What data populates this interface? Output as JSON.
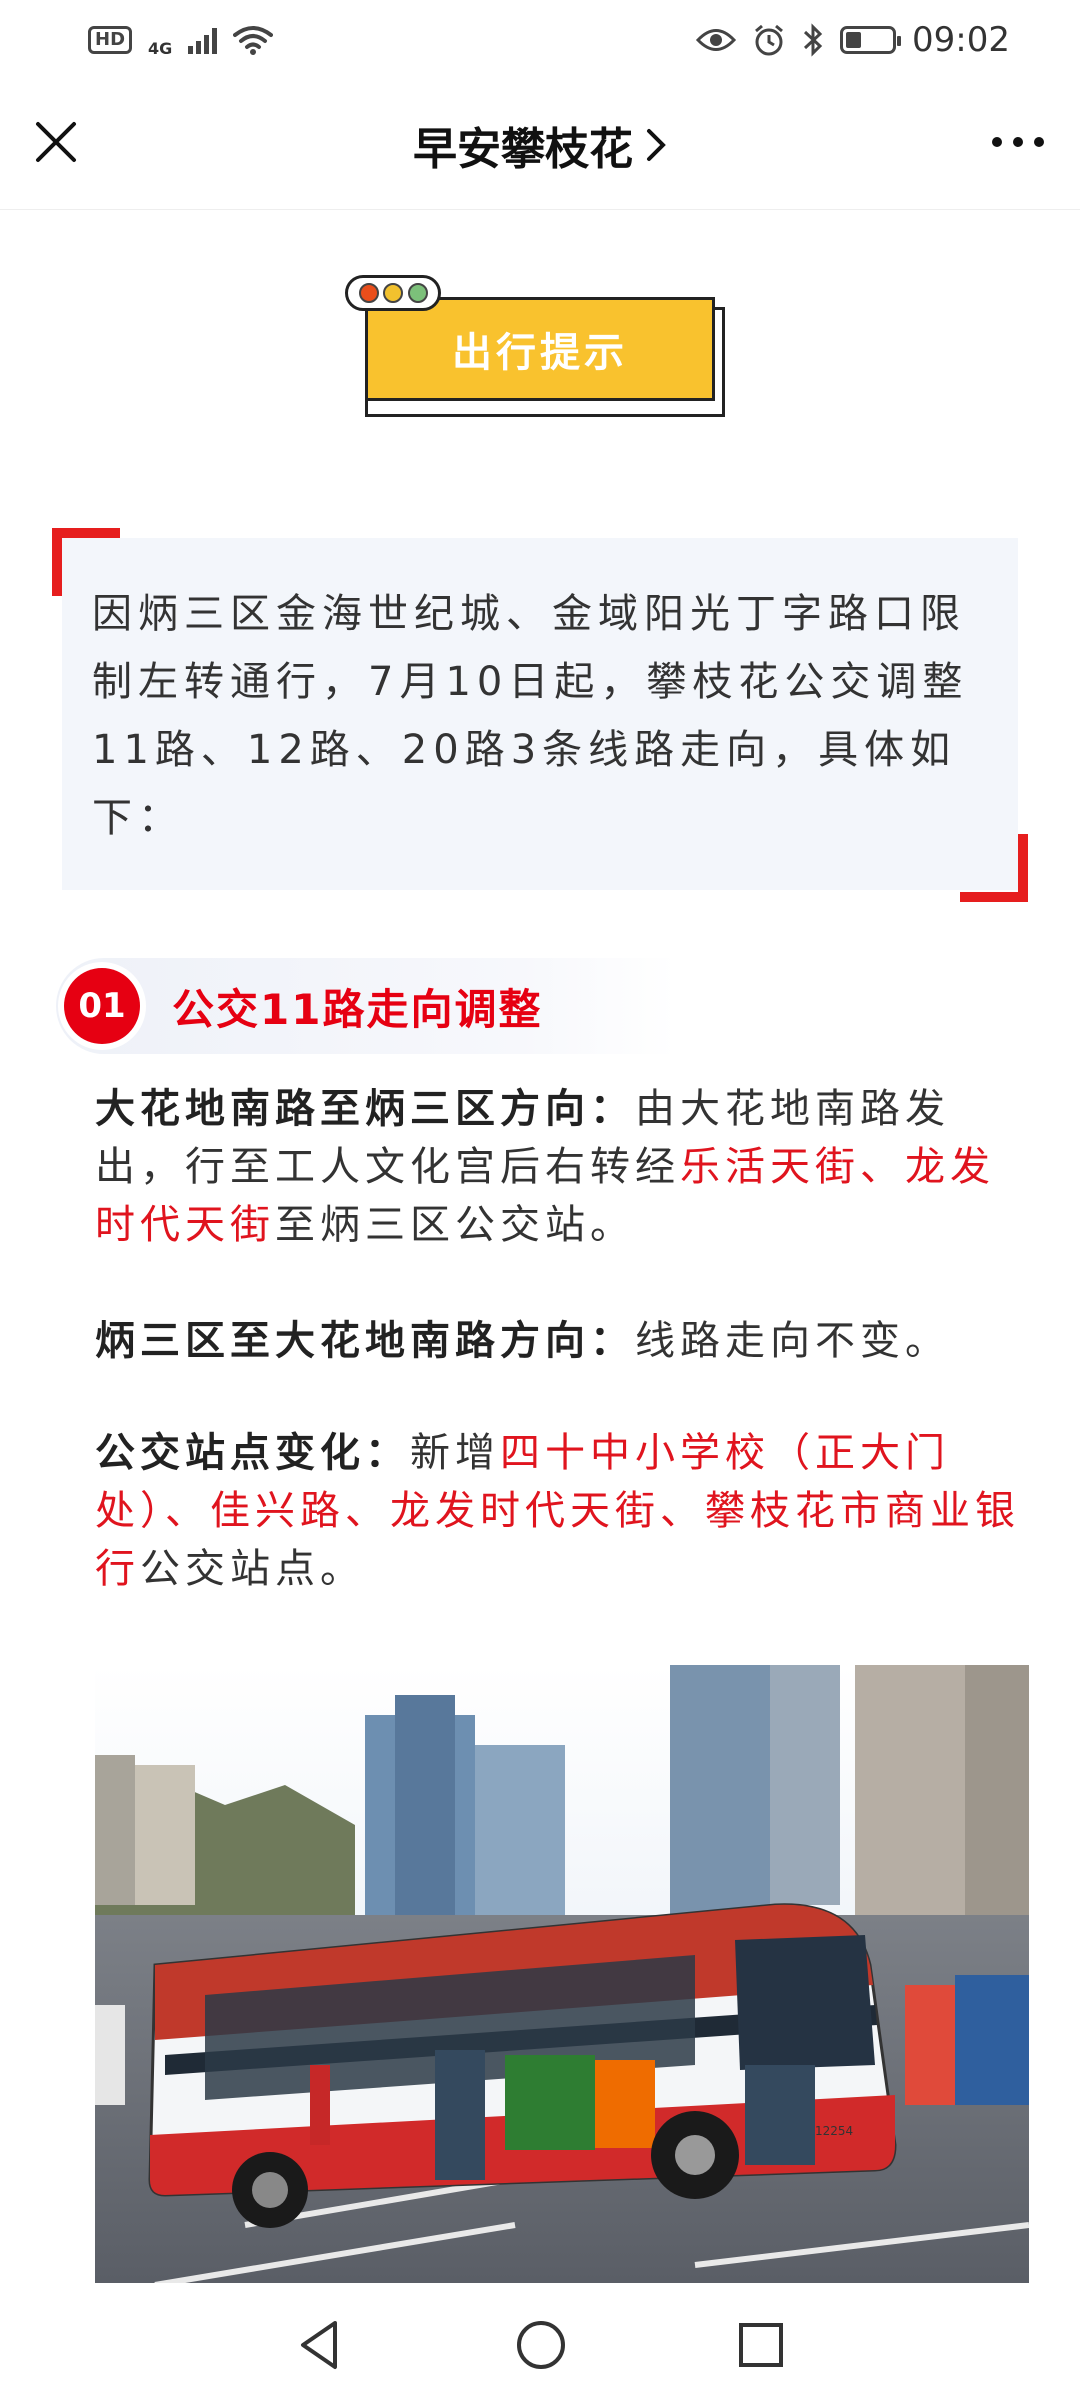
{
  "status_bar": {
    "hd": "HD",
    "network": "4G",
    "time": "09:02"
  },
  "nav": {
    "title": "早安攀枝花",
    "chevron": "›",
    "close_icon": "close-icon",
    "more_icon": "more-icon"
  },
  "tip_badge": {
    "label": "出行提示",
    "light_colors": [
      "#e94e1b",
      "#f2c12e",
      "#7cc07a"
    ]
  },
  "intro": {
    "text": "因炳三区金海世纪城、金域阳光丁字路口限制左转通行，7月10日起，攀枝花公交调整11路、12路、20路3条线路走向，具体如下："
  },
  "section": {
    "number": "01",
    "title": "公交11路走向调整"
  },
  "paragraphs": {
    "p1_label": "大花地南路至炳三区方向：",
    "p1_text_a": "由大花地南路发出，行至工人文化宫后右转经",
    "p1_highlight": "乐活天街、龙发时代天街",
    "p1_text_b": "至炳三区公交站。",
    "p2_label": "炳三区至大花地南路方向：",
    "p2_text": "线路走向不变。",
    "p3_label": "公交站点变化：",
    "p3_text_a": "新增",
    "p3_highlight": "四十中小学校（正大门处）、佳兴路、龙发时代天街、攀枝花市商业银行",
    "p3_text_b": "公交站点。"
  },
  "photo": {
    "bus_number": "12254"
  },
  "colors": {
    "accent_red": "#e60012",
    "badge_yellow": "#f9c22e",
    "intro_bg": "#f3f6fb"
  }
}
